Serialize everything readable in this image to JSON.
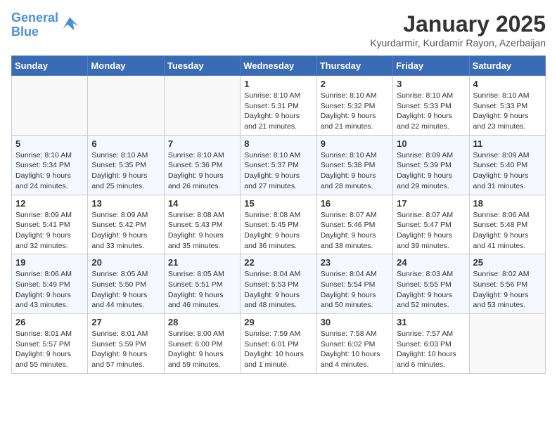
{
  "header": {
    "logo_line1": "General",
    "logo_line2": "Blue",
    "title": "January 2025",
    "subtitle": "Kyurdarmir, Kurdamir Rayon, Azerbaijan"
  },
  "calendar": {
    "days_of_week": [
      "Sunday",
      "Monday",
      "Tuesday",
      "Wednesday",
      "Thursday",
      "Friday",
      "Saturday"
    ],
    "weeks": [
      [
        {
          "day": "",
          "info": ""
        },
        {
          "day": "",
          "info": ""
        },
        {
          "day": "",
          "info": ""
        },
        {
          "day": "1",
          "info": "Sunrise: 8:10 AM\nSunset: 5:31 PM\nDaylight: 9 hours and 21 minutes."
        },
        {
          "day": "2",
          "info": "Sunrise: 8:10 AM\nSunset: 5:32 PM\nDaylight: 9 hours and 21 minutes."
        },
        {
          "day": "3",
          "info": "Sunrise: 8:10 AM\nSunset: 5:33 PM\nDaylight: 9 hours and 22 minutes."
        },
        {
          "day": "4",
          "info": "Sunrise: 8:10 AM\nSunset: 5:33 PM\nDaylight: 9 hours and 23 minutes."
        }
      ],
      [
        {
          "day": "5",
          "info": "Sunrise: 8:10 AM\nSunset: 5:34 PM\nDaylight: 9 hours and 24 minutes."
        },
        {
          "day": "6",
          "info": "Sunrise: 8:10 AM\nSunset: 5:35 PM\nDaylight: 9 hours and 25 minutes."
        },
        {
          "day": "7",
          "info": "Sunrise: 8:10 AM\nSunset: 5:36 PM\nDaylight: 9 hours and 26 minutes."
        },
        {
          "day": "8",
          "info": "Sunrise: 8:10 AM\nSunset: 5:37 PM\nDaylight: 9 hours and 27 minutes."
        },
        {
          "day": "9",
          "info": "Sunrise: 8:10 AM\nSunset: 5:38 PM\nDaylight: 9 hours and 28 minutes."
        },
        {
          "day": "10",
          "info": "Sunrise: 8:09 AM\nSunset: 5:39 PM\nDaylight: 9 hours and 29 minutes."
        },
        {
          "day": "11",
          "info": "Sunrise: 8:09 AM\nSunset: 5:40 PM\nDaylight: 9 hours and 31 minutes."
        }
      ],
      [
        {
          "day": "12",
          "info": "Sunrise: 8:09 AM\nSunset: 5:41 PM\nDaylight: 9 hours and 32 minutes."
        },
        {
          "day": "13",
          "info": "Sunrise: 8:09 AM\nSunset: 5:42 PM\nDaylight: 9 hours and 33 minutes."
        },
        {
          "day": "14",
          "info": "Sunrise: 8:08 AM\nSunset: 5:43 PM\nDaylight: 9 hours and 35 minutes."
        },
        {
          "day": "15",
          "info": "Sunrise: 8:08 AM\nSunset: 5:45 PM\nDaylight: 9 hours and 36 minutes."
        },
        {
          "day": "16",
          "info": "Sunrise: 8:07 AM\nSunset: 5:46 PM\nDaylight: 9 hours and 38 minutes."
        },
        {
          "day": "17",
          "info": "Sunrise: 8:07 AM\nSunset: 5:47 PM\nDaylight: 9 hours and 39 minutes."
        },
        {
          "day": "18",
          "info": "Sunrise: 8:06 AM\nSunset: 5:48 PM\nDaylight: 9 hours and 41 minutes."
        }
      ],
      [
        {
          "day": "19",
          "info": "Sunrise: 8:06 AM\nSunset: 5:49 PM\nDaylight: 9 hours and 43 minutes."
        },
        {
          "day": "20",
          "info": "Sunrise: 8:05 AM\nSunset: 5:50 PM\nDaylight: 9 hours and 44 minutes."
        },
        {
          "day": "21",
          "info": "Sunrise: 8:05 AM\nSunset: 5:51 PM\nDaylight: 9 hours and 46 minutes."
        },
        {
          "day": "22",
          "info": "Sunrise: 8:04 AM\nSunset: 5:53 PM\nDaylight: 9 hours and 48 minutes."
        },
        {
          "day": "23",
          "info": "Sunrise: 8:04 AM\nSunset: 5:54 PM\nDaylight: 9 hours and 50 minutes."
        },
        {
          "day": "24",
          "info": "Sunrise: 8:03 AM\nSunset: 5:55 PM\nDaylight: 9 hours and 52 minutes."
        },
        {
          "day": "25",
          "info": "Sunrise: 8:02 AM\nSunset: 5:56 PM\nDaylight: 9 hours and 53 minutes."
        }
      ],
      [
        {
          "day": "26",
          "info": "Sunrise: 8:01 AM\nSunset: 5:57 PM\nDaylight: 9 hours and 55 minutes."
        },
        {
          "day": "27",
          "info": "Sunrise: 8:01 AM\nSunset: 5:59 PM\nDaylight: 9 hours and 57 minutes."
        },
        {
          "day": "28",
          "info": "Sunrise: 8:00 AM\nSunset: 6:00 PM\nDaylight: 9 hours and 59 minutes."
        },
        {
          "day": "29",
          "info": "Sunrise: 7:59 AM\nSunset: 6:01 PM\nDaylight: 10 hours and 1 minute."
        },
        {
          "day": "30",
          "info": "Sunrise: 7:58 AM\nSunset: 6:02 PM\nDaylight: 10 hours and 4 minutes."
        },
        {
          "day": "31",
          "info": "Sunrise: 7:57 AM\nSunset: 6:03 PM\nDaylight: 10 hours and 6 minutes."
        },
        {
          "day": "",
          "info": ""
        }
      ]
    ]
  }
}
